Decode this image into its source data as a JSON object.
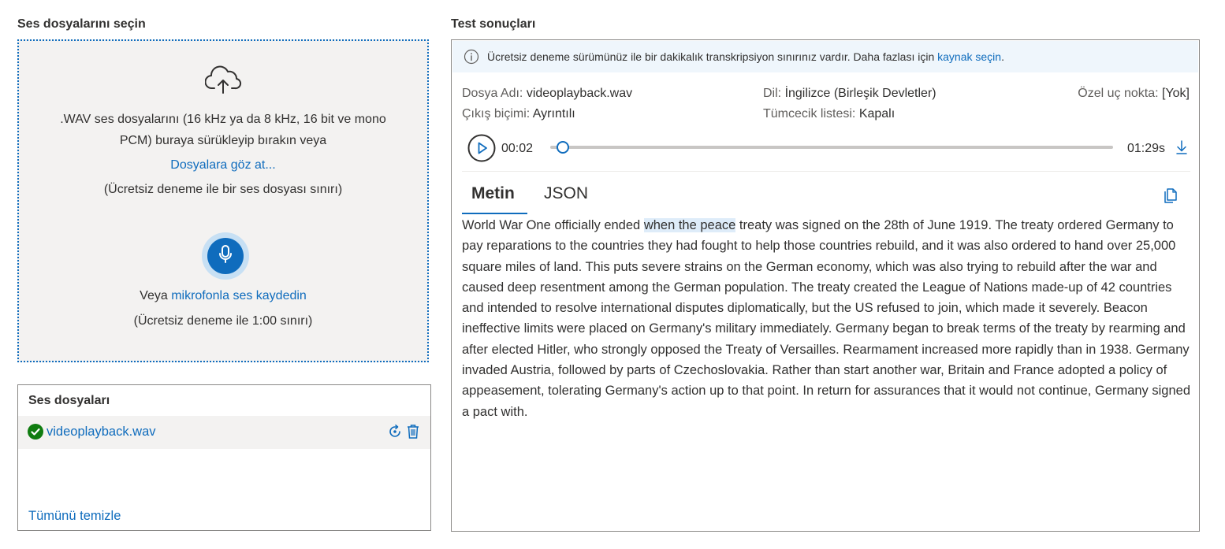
{
  "left": {
    "title": "Ses dosyalarını seçin",
    "upload_text_line1": ".WAV ses dosyalarını (16 kHz ya da 8 kHz, 16 bit ve mono",
    "upload_text_line2": "PCM) buraya sürükleyip bırakın veya",
    "browse_link": "Dosyalara göz at...",
    "file_limit_note": "(Ücretsiz deneme ile bir ses dosyası sınırı)",
    "mic_prefix": "Veya ",
    "mic_link": "mikrofonla ses kaydedin",
    "mic_limit_note": "(Ücretsiz deneme ile 1:00 sınırı)"
  },
  "files": {
    "title": "Ses dosyaları",
    "items": [
      {
        "name": "videoplayback.wav",
        "status": "success"
      }
    ],
    "clear_all": "Tümünü temizle"
  },
  "results": {
    "title": "Test sonuçları",
    "info_text": "Ücretsiz deneme sürümünüz ile bir dakikalık transkripsiyon sınırınız vardır. Daha fazlası için ",
    "info_link": "kaynak seçin",
    "info_suffix": ".",
    "meta": {
      "file_label": "Dosya Adı:",
      "file_value": "videoplayback.wav",
      "lang_label": "Dil:",
      "lang_value": "İngilizce (Birleşik Devletler)",
      "endpoint_label": "Özel uç nokta:",
      "endpoint_value": "[Yok]",
      "format_label": "Çıkış biçimi:",
      "format_value": "Ayrıntılı",
      "phrase_label": "Tümcecik listesi:",
      "phrase_value": "Kapalı"
    },
    "player": {
      "current_time": "00:02",
      "duration": "01:29s",
      "progress_fraction": 0.022
    },
    "tabs": [
      {
        "label": "Metin",
        "active": true
      },
      {
        "label": "JSON",
        "active": false
      }
    ],
    "transcript_before": "World War One officially ended ",
    "transcript_highlight": "when the peace",
    "transcript_after": " treaty was signed on the 28th of June 1919. The treaty ordered Germany to pay reparations to the countries they had fought to help those countries rebuild, and it was also ordered to hand over 25,000 square miles of land. This puts severe strains on the German economy, which was also trying to rebuild after the war and caused deep resentment among the German population. The treaty created the League of Nations made-up of 42 countries and intended to resolve international disputes diplomatically, but the US refused to join, which made it severely. Beacon ineffective limits were placed on Germany's military immediately. Germany began to break terms of the treaty by rearming and after elected Hitler, who strongly opposed the Treaty of Versailles. Rearmament increased more rapidly than in 1938. Germany invaded Austria, followed by parts of Czechoslovakia. Rather than start another war, Britain and France adopted a policy of appeasement, tolerating Germany's action up to that point. In return for assurances that it would not continue, Germany signed a pact with."
  },
  "colors": {
    "accent": "#0f6cbd",
    "success": "#107c10",
    "highlight": "#deecf9",
    "info_bar": "#eff6fc"
  },
  "icons": {
    "upload": "cloud-upload-icon",
    "mic": "microphone-icon",
    "check": "checkmark-circle-icon",
    "retry": "retry-icon",
    "delete": "trash-icon",
    "info": "info-icon",
    "play": "play-icon",
    "download": "download-icon",
    "copy": "copy-icon"
  }
}
